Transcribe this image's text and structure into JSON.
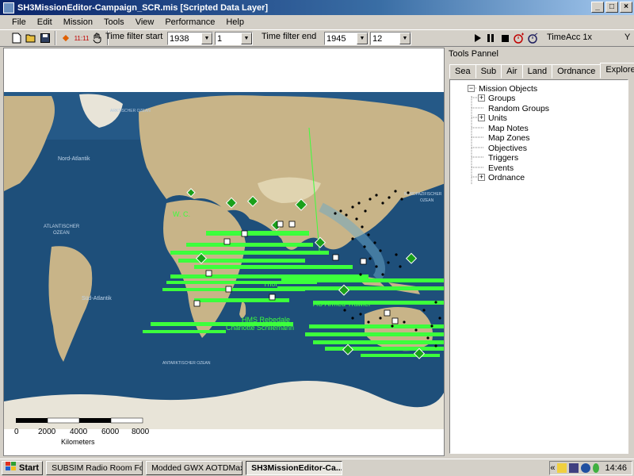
{
  "window": {
    "title": "SH3MissionEditor-Campaign_SCR.mis [Scripted Data Layer]",
    "min_label": "_",
    "max_label": "□",
    "close_label": "×"
  },
  "menu": [
    "File",
    "Edit",
    "Mission",
    "Tools",
    "View",
    "Performance",
    "Help"
  ],
  "toolbar": {
    "time_label": "11:11",
    "time_filter_start_label": "Time filter start",
    "start_year": "1938",
    "start_month": "1",
    "time_filter_end_label": "Time filter end",
    "end_year": "1945",
    "end_month": "12",
    "timeacc_label": "TimeAcc 1x",
    "y_label": "Y"
  },
  "map": {
    "ocean_labels": {
      "arctic": "ARKTISCHER OZEAN",
      "north_atlantic": "Nord-Atlantik",
      "atlantic": "ATLANTISCHER\nOZEAN",
      "south_atlantic": "Süd-Atlantik",
      "antarctic": "ANTARKTISCHER OZEAN",
      "north_pacific": "NORDPAZIFISCHER\nOZEAN"
    },
    "unit_labels": [
      "Thor",
      "Charlotte Schliemann",
      "AU Armed Trawler",
      "HMS Rebedale"
    ],
    "scale": {
      "ticks": [
        "0",
        "2000",
        "4000",
        "6000",
        "8000"
      ],
      "unit": "Kilometers"
    }
  },
  "panel": {
    "title": "Tools Pannel",
    "tabs": [
      "Sea",
      "Sub",
      "Air",
      "Land",
      "Ordnance",
      "Explorer"
    ],
    "active_tab": "Explorer",
    "tree_root": "Mission Objects",
    "tree_items": [
      "Groups",
      "Random Groups",
      "Units",
      "Map Notes",
      "Map Zones",
      "Objectives",
      "Triggers",
      "Events",
      "Ordnance"
    ]
  },
  "taskbar": {
    "start_label": "Start",
    "buttons": [
      "SUBSIM Radio Room For...",
      "Modded GWX AOTDMax",
      "SH3MissionEditor-Ca..."
    ],
    "clock": "14:46",
    "tray_chevron": "«"
  },
  "colors": {
    "title_active": "#0a246a",
    "ocean": "#1e4f7a",
    "unit_green": "#3cff3c",
    "land": "#c8b488"
  }
}
